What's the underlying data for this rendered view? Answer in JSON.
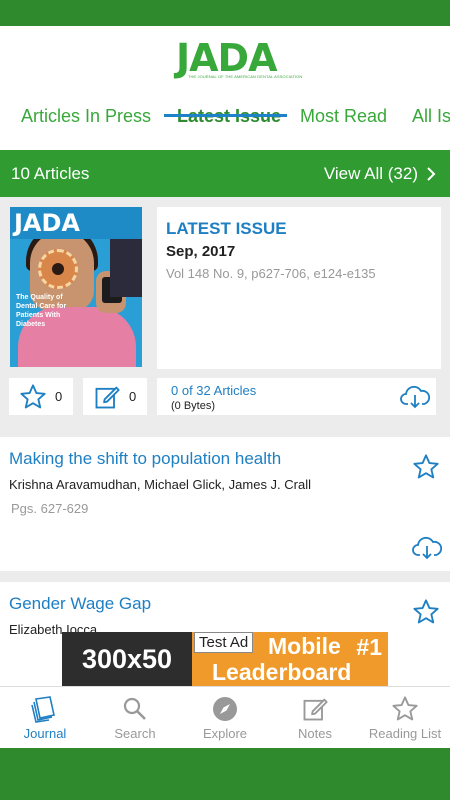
{
  "header": {
    "logo_text": "JADA",
    "logo_subtext": "THE JOURNAL OF THE AMERICAN DENTAL ASSOCIATION"
  },
  "tabs": [
    {
      "label": "Articles In Press"
    },
    {
      "label": "Latest Issue"
    },
    {
      "label": "Most Read"
    },
    {
      "label": "All Is"
    }
  ],
  "count_bar": {
    "count_label": "10 Articles",
    "view_all_label": "View All (32)"
  },
  "issue": {
    "cover_title": "JADA",
    "cover_caption": "The Quality of Dental Care for Patients With Diabetes",
    "label": "LATEST ISSUE",
    "date": "Sep, 2017",
    "volume": "Vol 148 No. 9, p627-706, e124-e135",
    "favorites_count": "0",
    "notes_count": "0",
    "download_count": "0 of 32 Articles",
    "download_size": "(0 Bytes)"
  },
  "articles": [
    {
      "title": "Making the shift to population health",
      "authors": "Krishna Aravamudhan, Michael Glick, James J. Crall",
      "pages": "Pgs. 627-629"
    },
    {
      "title": "Gender Wage Gap",
      "authors": "Elizabeth Iocca"
    }
  ],
  "ad": {
    "size_label": "300x50",
    "tag": "Test Ad",
    "line1": "Mobile",
    "rank": "#1",
    "line2": "Leaderboard"
  },
  "bottom_nav": [
    {
      "label": "Journal",
      "icon": "journal-icon"
    },
    {
      "label": "Search",
      "icon": "search-icon"
    },
    {
      "label": "Explore",
      "icon": "compass-icon"
    },
    {
      "label": "Notes",
      "icon": "notes-icon"
    },
    {
      "label": "Reading List",
      "icon": "star-icon"
    }
  ],
  "colors": {
    "brand_green": "#2f8a2e",
    "link_blue": "#1e7fc3"
  }
}
